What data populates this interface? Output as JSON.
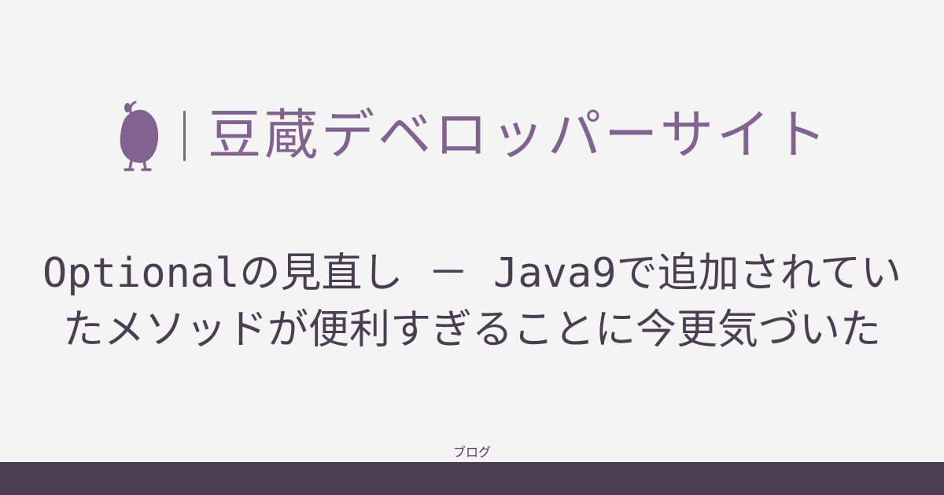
{
  "brand": {
    "name": "豆蔵デベロッパーサイト",
    "logo_icon": "bean-mascot-icon",
    "color": "#82628e"
  },
  "article": {
    "title": "Optionalの見直し － Java9で追加されていたメソッドが便利すぎることに今更気づいた",
    "text_color": "#4a3f51"
  },
  "category": {
    "label": "ブログ"
  },
  "theme": {
    "background": "#f4f4f4",
    "footer_bar": "#4a3f51"
  }
}
